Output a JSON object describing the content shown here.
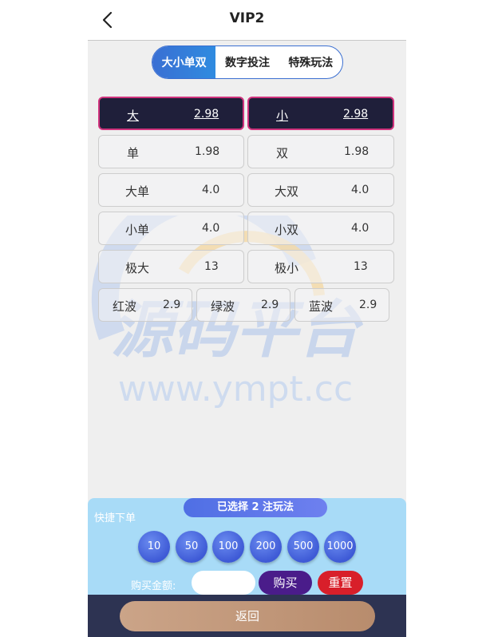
{
  "header": {
    "title": "VIP2",
    "back_icon": "chevron-left-icon"
  },
  "tabs": [
    {
      "label": "大小单双",
      "active": true
    },
    {
      "label": "数字投注",
      "active": false
    },
    {
      "label": "特殊玩法",
      "active": false
    }
  ],
  "watermark": {
    "title": "源码平台",
    "url": "www.ympt.cc"
  },
  "bets": [
    {
      "name": "大",
      "odds": "2.98",
      "selected": true
    },
    {
      "name": "小",
      "odds": "2.98",
      "selected": true
    },
    {
      "name": "单",
      "odds": "1.98",
      "selected": false
    },
    {
      "name": "双",
      "odds": "1.98",
      "selected": false
    },
    {
      "name": "大单",
      "odds": "4.0",
      "selected": false
    },
    {
      "name": "大双",
      "odds": "4.0",
      "selected": false
    },
    {
      "name": "小单",
      "odds": "4.0",
      "selected": false
    },
    {
      "name": "小双",
      "odds": "4.0",
      "selected": false
    },
    {
      "name": "极大",
      "odds": "13",
      "selected": false
    },
    {
      "name": "极小",
      "odds": "13",
      "selected": false
    },
    {
      "name": "红波",
      "odds": "2.9",
      "selected": false
    },
    {
      "name": "绿波",
      "odds": "2.9",
      "selected": false
    },
    {
      "name": "蓝波",
      "odds": "2.9",
      "selected": false
    }
  ],
  "quick": {
    "selected_text": "已选择 2 注玩法",
    "label": "快捷下单",
    "chips": [
      "10",
      "50",
      "100",
      "200",
      "500",
      "1000"
    ],
    "amount_label": "购买金额:",
    "amount_value": "",
    "buy_label": "购买",
    "reset_label": "重置"
  },
  "footer": {
    "return_label": "返回"
  },
  "colors": {
    "selected_bg": "#1f1f3a",
    "selected_border": "#d0337d",
    "tab_active": "#2f8be0",
    "chip": "#4f6fe4",
    "buy": "#4a1c8a",
    "reset": "#d81f2a",
    "footer": "#2d3352",
    "return": "#c29a7b"
  }
}
